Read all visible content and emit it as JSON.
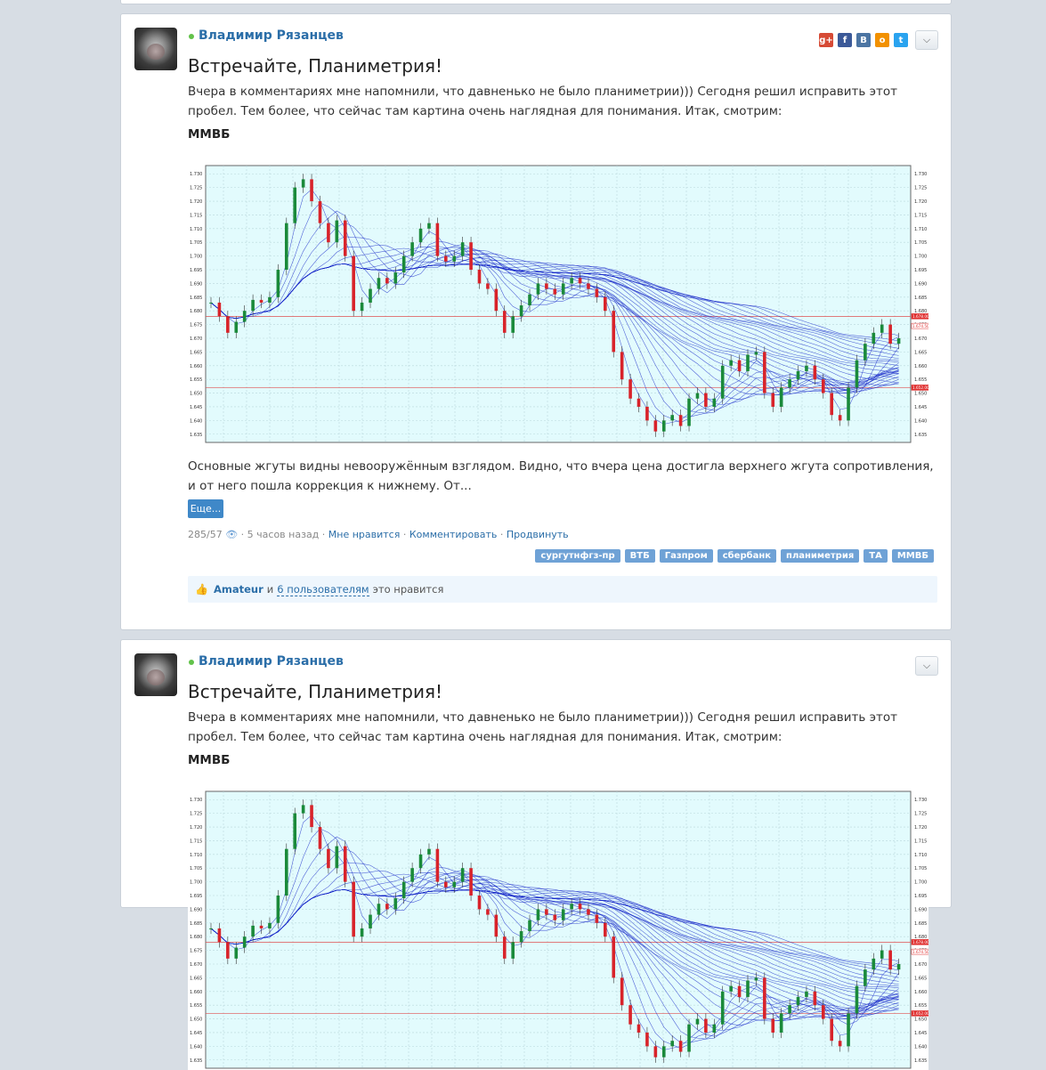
{
  "posts": [
    {
      "author": "Владимир Рязанцев",
      "title": "Встречайте, Планиметрия!",
      "intro": "Вчера в комментариях мне напомнили, что давненько не было планиметрии))) Сегодня решил исправить этот пробел. Тем более, что сейчас там картина очень наглядная для понимания. Итак, смотрим:",
      "ticker": "ММВБ",
      "body": "Основные жгуты видны невооружённым взглядом. Видно, что вчера цена достигла верхнего жгута сопротивления, и от него пошла коррекция к нижнему. От...",
      "more": "Еще...",
      "views": "285/57",
      "time": "· 5 часов назад ·",
      "like_link": "Мне нравится",
      "comment_link": "Комментировать",
      "promote_link": "Продвинуть",
      "tags": [
        "сургутнфгз-пр",
        "ВТБ",
        "Газпром",
        "сбербанк",
        "планиметрия",
        "ТА",
        "ММВБ"
      ],
      "likes_user": "Amateur",
      "likes_and": "и",
      "likes_count": "6 пользователям",
      "likes_tail": "это нравится"
    },
    {
      "author": "Владимир Рязанцев",
      "title": "Встречайте, Планиметрия!",
      "intro": "Вчера в комментариях мне напомнили, что давненько не было планиметрии))) Сегодня решил исправить этот пробел. Тем более, что сейчас там картина очень наглядная для понимания. Итак, смотрим:",
      "ticker": "ММВБ"
    }
  ],
  "share_icons": [
    "google-plus-icon",
    "facebook-icon",
    "vk-icon",
    "odnoklassniki-icon",
    "twitter-icon"
  ],
  "menu_icon": "chevron-down-icon",
  "chart_data": {
    "type": "candlestick",
    "yticks": [
      "1.730",
      "1.725",
      "1.720",
      "1.715",
      "1.710",
      "1.705",
      "1.700",
      "1.695",
      "1.690",
      "1.685",
      "1.680",
      "1.675",
      "1.670",
      "1.665",
      "1.660",
      "1.655",
      "1.650",
      "1.645",
      "1.640",
      "1.635"
    ],
    "ylim": [
      1.632,
      1.733
    ],
    "price_marks": [
      "1.678.00",
      "1.674.50",
      "1.652.00"
    ],
    "closes": [
      1.683,
      1.678,
      1.672,
      1.676,
      1.68,
      1.684,
      1.683,
      1.685,
      1.695,
      1.712,
      1.725,
      1.728,
      1.72,
      1.712,
      1.705,
      1.713,
      1.7,
      1.68,
      1.683,
      1.688,
      1.692,
      1.69,
      1.694,
      1.7,
      1.705,
      1.71,
      1.712,
      1.7,
      1.698,
      1.7,
      1.705,
      1.695,
      1.69,
      1.688,
      1.68,
      1.672,
      1.678,
      1.682,
      1.686,
      1.69,
      1.688,
      1.686,
      1.69,
      1.692,
      1.69,
      1.688,
      1.685,
      1.68,
      1.665,
      1.655,
      1.648,
      1.645,
      1.64,
      1.636,
      1.64,
      1.642,
      1.638,
      1.648,
      1.65,
      1.645,
      1.648,
      1.66,
      1.662,
      1.658,
      1.664,
      1.665,
      1.65,
      1.645,
      1.652,
      1.655,
      1.658,
      1.66,
      1.655,
      1.65,
      1.642,
      1.64,
      1.652,
      1.662,
      1.668,
      1.672,
      1.675,
      1.668,
      1.67
    ],
    "colors": {
      "up": "#1a8a3a",
      "down": "#d8232a",
      "band": "#1525c8",
      "bg": "#e2fbfd"
    }
  }
}
